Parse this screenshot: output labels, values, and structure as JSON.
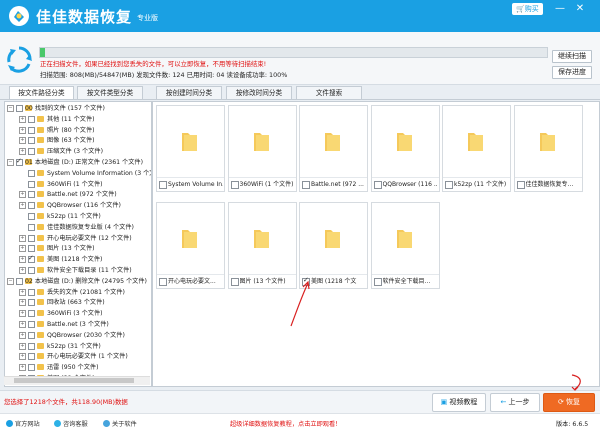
{
  "app": {
    "title": "佳佳数据恢复",
    "edition": "专业版",
    "buy_label": "购买",
    "min_icon": "minimize-icon",
    "close_icon": "close-icon"
  },
  "scan": {
    "progress": 0.01,
    "warning": "正在扫描文件，如果已经找到您丢失的文件，可以立即恢复，不用等待扫描结束!",
    "stats": "扫描范围: 808(MB)/54847(MB)    发现文件数: 124    已用时间: 04    读设备成功率: 100%",
    "continue_label": "继续扫描",
    "save_label": "保存进度"
  },
  "tabs": [
    "按文件路径分类",
    "按文件类型分类",
    "按创建时间分类",
    "按修改时间分类",
    "文件搜索"
  ],
  "tree": [
    {
      "label": "00 找到的文件      (157 个文件)",
      "level": 0,
      "exp": "−",
      "checked": false
    },
    {
      "label": "其他      (11 个文件)",
      "level": 1,
      "exp": "+",
      "checked": false
    },
    {
      "label": "照片      (80 个文件)",
      "level": 1,
      "exp": "+",
      "checked": false
    },
    {
      "label": "图像      (63 个文件)",
      "level": 1,
      "exp": "+",
      "checked": false
    },
    {
      "label": "压缩文件    (3 个文件)",
      "level": 1,
      "exp": "+",
      "checked": false
    },
    {
      "label": "01 本地磁盘 (D:) 正常文件   (2361 个文件)",
      "level": 0,
      "exp": "−",
      "checked": true
    },
    {
      "label": "System Volume Information      (3 个文件)",
      "level": 1,
      "exp": "",
      "checked": false
    },
    {
      "label": "360WiFi    (1 个文件)",
      "level": 1,
      "exp": "",
      "checked": false
    },
    {
      "label": "Battle.net    (972 个文件)",
      "level": 1,
      "exp": "+",
      "checked": false
    },
    {
      "label": "QQBrowser    (116 个文件)",
      "level": 1,
      "exp": "+",
      "checked": false
    },
    {
      "label": "k52zp    (11 个文件)",
      "level": 1,
      "exp": "",
      "checked": false
    },
    {
      "label": "佳佳数据恢复专业版   (4 个文件)",
      "level": 1,
      "exp": "",
      "checked": false
    },
    {
      "label": "开心电玩必要文件    (12 个文件)",
      "level": 1,
      "exp": "+",
      "checked": false
    },
    {
      "label": "图片    (13 个文件)",
      "level": 1,
      "exp": "+",
      "checked": false
    },
    {
      "label": "美图    (1218 个文件)",
      "level": 1,
      "exp": "+",
      "checked": true
    },
    {
      "label": "软件安全下载目录     (11 个文件)",
      "level": 1,
      "exp": "+",
      "checked": false
    },
    {
      "label": "02 本地磁盘 (D:) 删除文件   (24795 个文件)",
      "level": 0,
      "exp": "−",
      "checked": false
    },
    {
      "label": "丢失的文件     (21081 个文件)",
      "level": 1,
      "exp": "+",
      "checked": false
    },
    {
      "label": "回收站    (663 个文件)",
      "level": 1,
      "exp": "+",
      "checked": false
    },
    {
      "label": "360WiFi    (3 个文件)",
      "level": 1,
      "exp": "+",
      "checked": false
    },
    {
      "label": "Battle.net    (3 个文件)",
      "level": 1,
      "exp": "+",
      "checked": false
    },
    {
      "label": "QQBrowser    (2030 个文件)",
      "level": 1,
      "exp": "+",
      "checked": false
    },
    {
      "label": "k52zp    (31 个文件)",
      "level": 1,
      "exp": "+",
      "checked": false
    },
    {
      "label": "开心电玩必要文件    (1 个文件)",
      "level": 1,
      "exp": "+",
      "checked": false
    },
    {
      "label": "迅雷    (950 个文件)",
      "level": 1,
      "exp": "+",
      "checked": false
    },
    {
      "label": "美图    (32 个文件)",
      "level": 1,
      "exp": "+",
      "checked": false
    }
  ],
  "cards": [
    {
      "label": "System Volume In...",
      "checked": false
    },
    {
      "label": "360WiFi  (1 个文件)",
      "checked": false
    },
    {
      "label": "Battle.net  (972 ...",
      "checked": false
    },
    {
      "label": "QQBrowser  (116 ...",
      "checked": false
    },
    {
      "label": "k52zp  (11 个文件)",
      "checked": false
    },
    {
      "label": "佳佳数据恢复专...",
      "checked": false
    },
    {
      "label": "开心电玩必要文...",
      "checked": false
    },
    {
      "label": "图片  (13 个文件)",
      "checked": false
    },
    {
      "label": "美图  (1218 个文",
      "checked": true
    },
    {
      "label": "软件安全下载目...",
      "checked": false
    }
  ],
  "status": {
    "selected": "您选择了1218个文件，共118.90(MB)数据",
    "video_label": "视频教程",
    "prev_label": "上一步",
    "recover_label": "恢复"
  },
  "footer": {
    "site": "官方网站",
    "support": "咨询客服",
    "about": "关于软件",
    "promo": "超级详细数据恢复教程，点击立即观看！",
    "version": "版本: 6.6.5"
  },
  "colors": {
    "brand": "#1aa0e3",
    "warning": "#e01010",
    "progress": "#49c86a",
    "recover": "#ef6a23",
    "annotation": "#d92020"
  }
}
